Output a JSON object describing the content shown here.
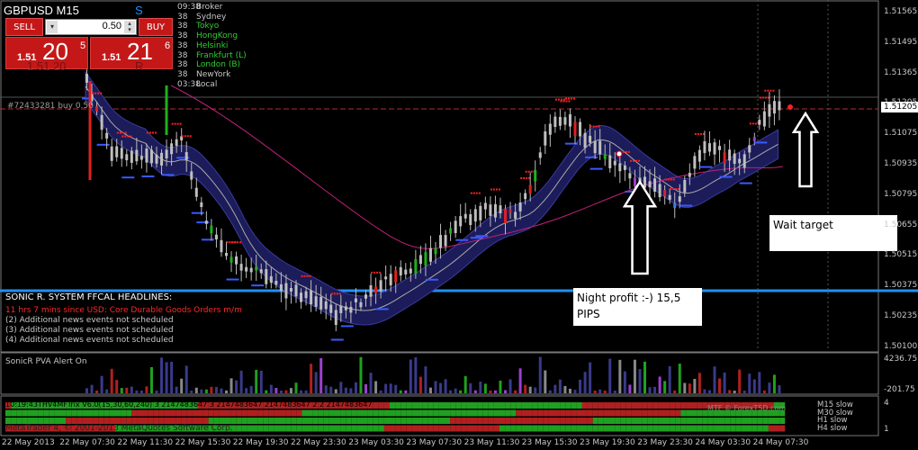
{
  "window": {
    "symbol_title": "GBPUSD   M15",
    "s_label": "S"
  },
  "trade_panel": {
    "sell_label": "SELL",
    "buy_label": "BUY",
    "lot_value": "0.50",
    "sell_price_small": "1.51",
    "sell_price_big": "20",
    "sell_price_sup": "5",
    "buy_price_small": "1.51",
    "buy_price_big": "21",
    "buy_price_sup": "6",
    "ghost_text": "1.51 20",
    "ghost_text_r": "R"
  },
  "sessions": [
    {
      "time": "09:38",
      "name": "Broker",
      "color": "#c8c8c8"
    },
    {
      "time": "38",
      "name": "Sydney",
      "color": "#c8c8c8"
    },
    {
      "time": "38",
      "name": "Tokyo",
      "color": "#32cd32"
    },
    {
      "time": "38",
      "name": "HongKong",
      "color": "#32cd32"
    },
    {
      "time": "38",
      "name": "Helsinki",
      "color": "#32cd32"
    },
    {
      "time": "38",
      "name": "Frankfurt  (L)",
      "color": "#32cd32"
    },
    {
      "time": "38",
      "name": "London  (B)",
      "color": "#32cd32"
    },
    {
      "time": "38",
      "name": "NewYork",
      "color": "#c8c8c8"
    },
    {
      "time": "03:38",
      "name": "Local",
      "color": "#c8c8c8"
    }
  ],
  "order_label": "#72433281 buy 0.50",
  "price_axis": {
    "labels": [
      "1.51565",
      "1.51495",
      "1.51365",
      "1.51205",
      "1.51075",
      "1.50935",
      "1.50795",
      "1.50655",
      "1.50515",
      "1.50375",
      "1.50235",
      "1.50100"
    ],
    "current_price": "1.51205",
    "colors": {
      "current_price_bg": "#ffffff",
      "accent_red": "#e00000",
      "blue_line": "#1e90ff"
    }
  },
  "headlines": {
    "title": "SONIC R. SYSTEM  FFCAL HEADLINES:",
    "items": [
      {
        "text": "11 hrs 7 mins since USD: Core Durable Goods Orders m/m",
        "color": "#ff2a2a"
      },
      {
        "text": "(2)  Additional news events not scheduled",
        "color": "#c8c8c8"
      },
      {
        "text": "(3)  Additional news events not scheduled",
        "color": "#c8c8c8"
      },
      {
        "text": "(4)  Additional news events not scheduled",
        "color": "#c8c8c8"
      }
    ]
  },
  "callouts": {
    "night_profit": "Night profit :-) 15,5 PIPS",
    "wait_target": "Wait target"
  },
  "volume_panel": {
    "title": "SonicR PVA   Alert On",
    "max_label": "4236.75",
    "min_label": "-201.75"
  },
  "trix_panel": {
    "header": "10:19:43THV4MFTrix V6.0(15,30,60,240) 3 2147483647 3 2147483647 2147483647 2 2 2147483647",
    "watermark": "MTF © ForexTSD.com",
    "copyright": "MetaTrader 4, © 2001-2013 MetaQuotes Software Corp.",
    "rows": [
      "M15 slow",
      "M30 slow",
      "H1 slow",
      "H4 slow"
    ],
    "right_top": "4",
    "right_bottom": "1"
  },
  "time_axis": [
    "22 May 2013",
    "22 May 07:30",
    "22 May 11:30",
    "22 May 15:30",
    "22 May 19:30",
    "22 May 23:30",
    "23 May 03:30",
    "23 May 07:30",
    "23 May 11:30",
    "23 May 15:30",
    "23 May 19:30",
    "23 May 23:30",
    "24 May 03:30",
    "24 May 07:30"
  ],
  "icons": [
    "arrow-up-icon",
    "close-dropdown-icon",
    "spinner-icon"
  ]
}
